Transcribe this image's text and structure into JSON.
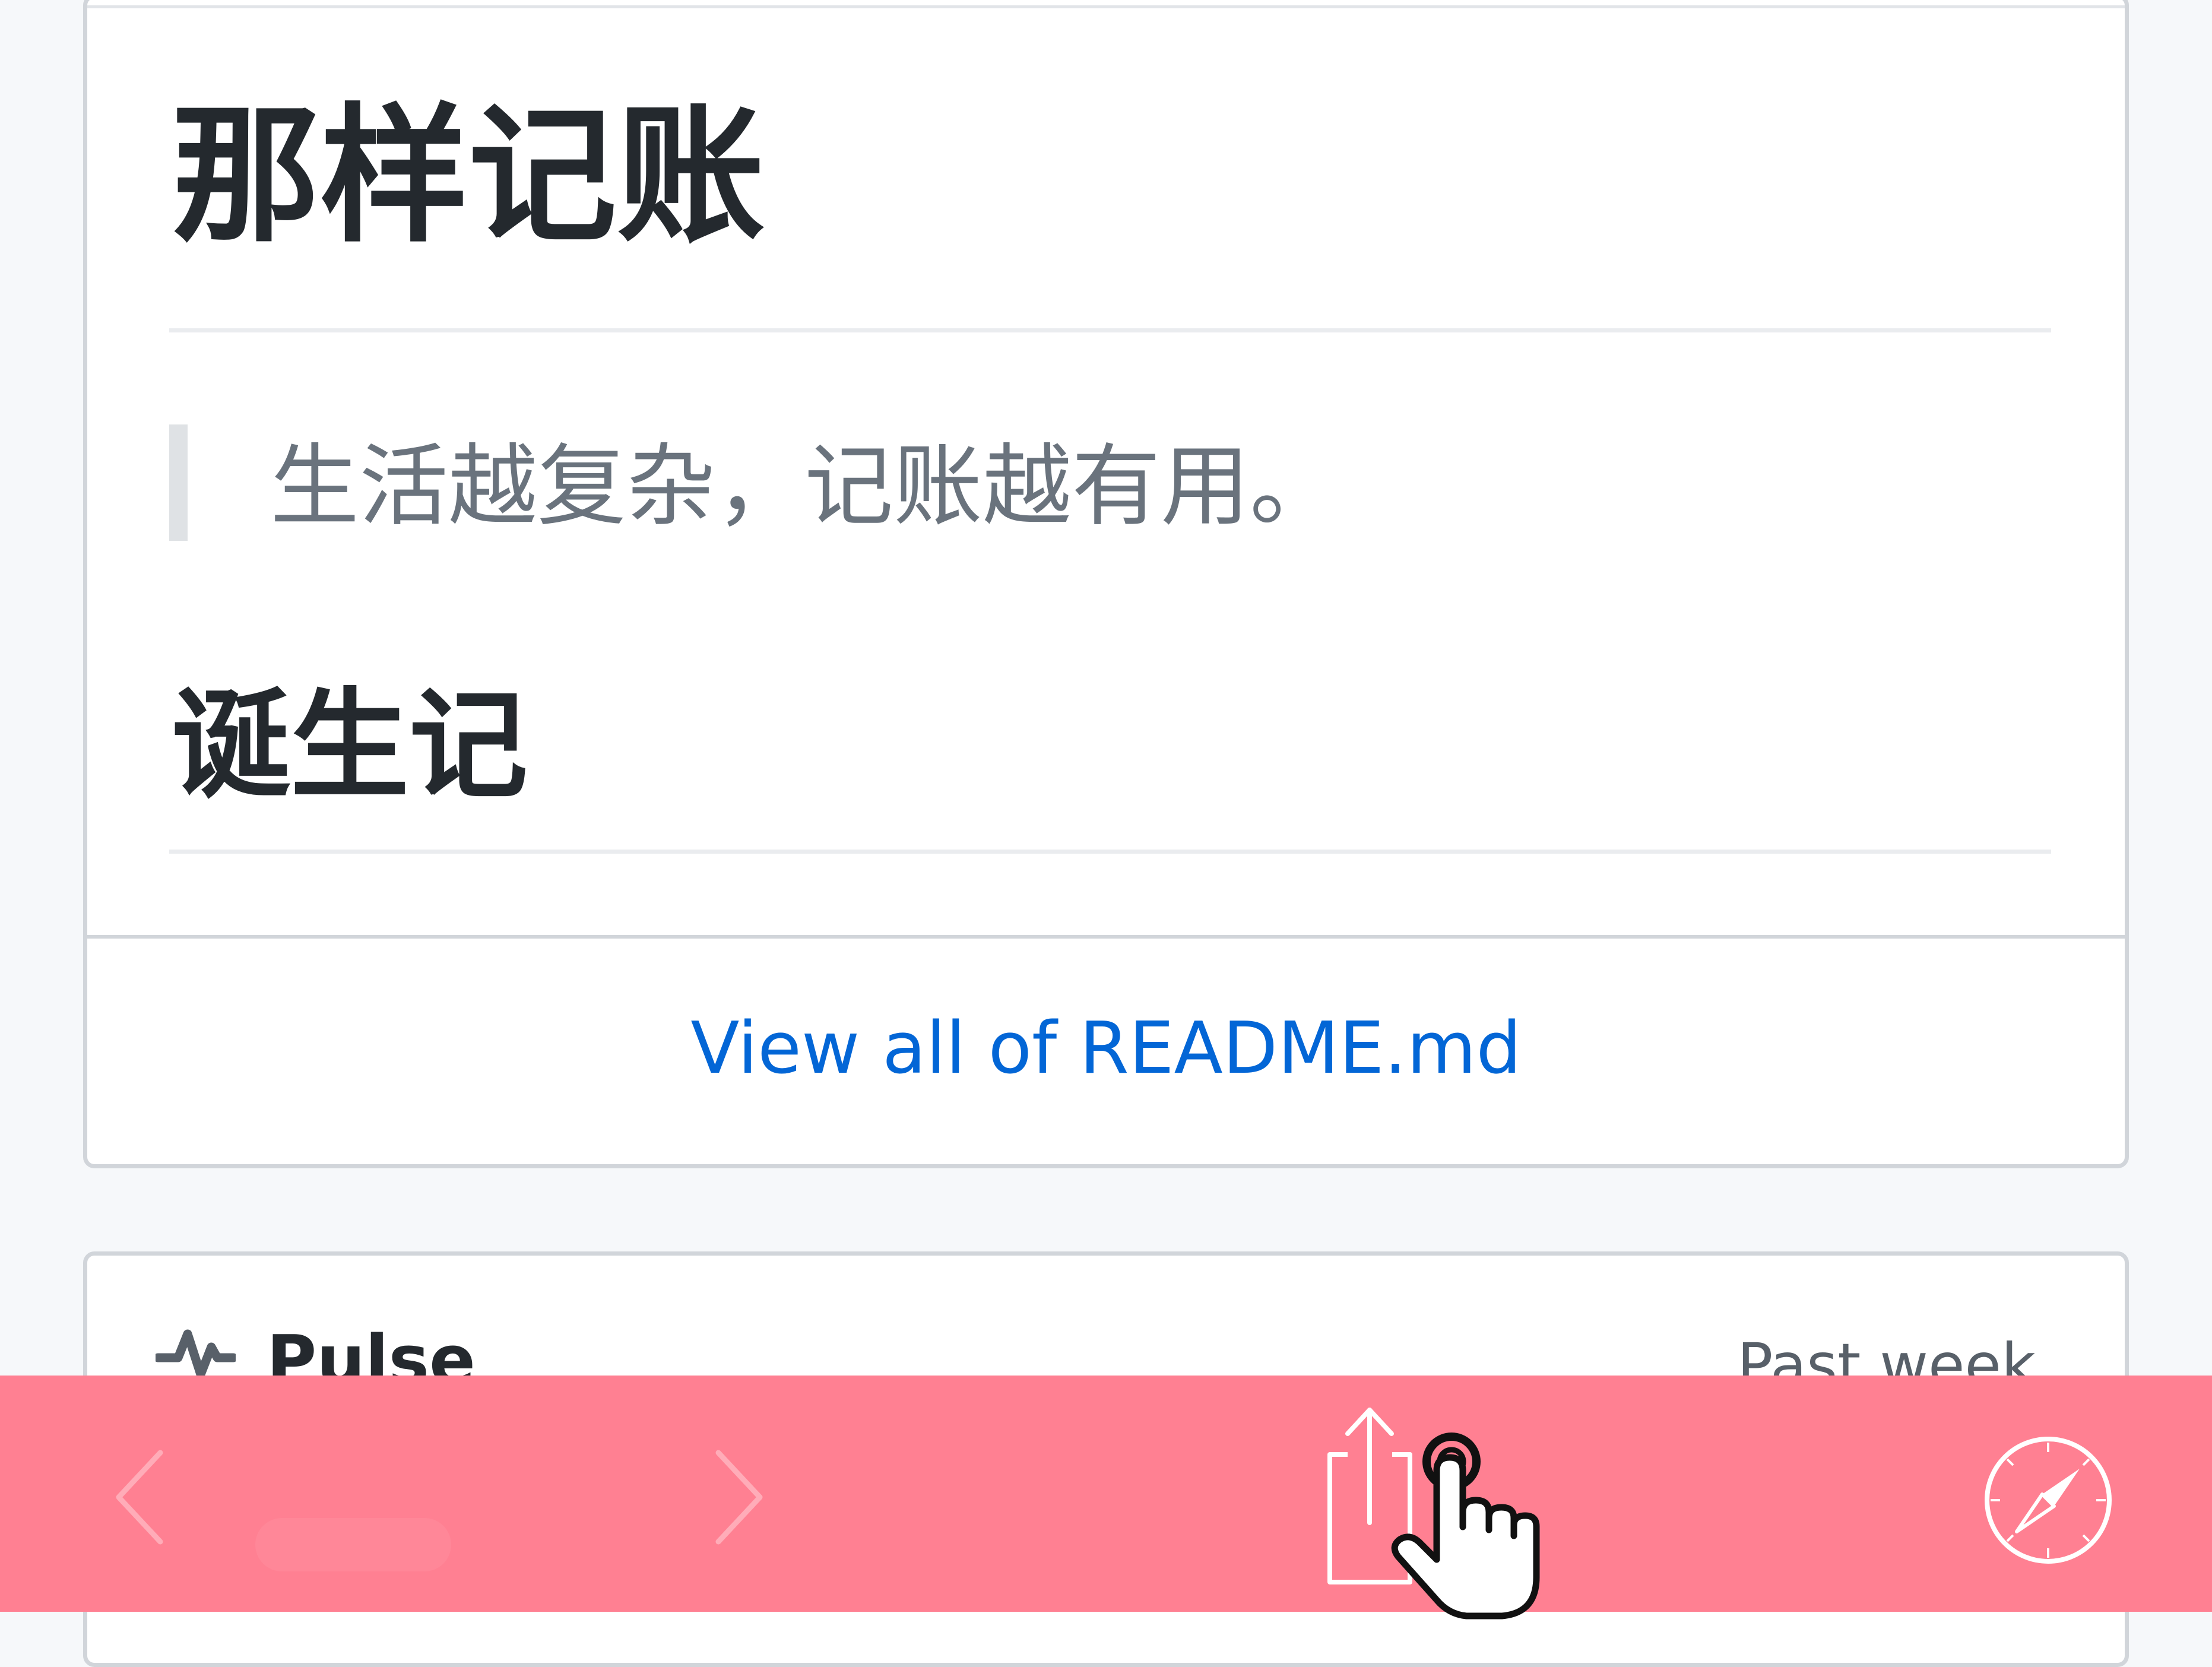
{
  "readme": {
    "heading": "那样记账",
    "quote": "生活越复杂，记账越有用。",
    "subheading": "诞生记",
    "view_all_label": "View all of README.md"
  },
  "pulse": {
    "title": "Pulse",
    "period": "Past week"
  },
  "toolbar": {
    "buttons": [
      {
        "name": "back",
        "icon": "chevron-left-icon",
        "enabled": false
      },
      {
        "name": "forward",
        "icon": "chevron-right-icon",
        "enabled": false
      },
      {
        "name": "share",
        "icon": "share-icon",
        "enabled": true
      },
      {
        "name": "open-in-safari",
        "icon": "compass-icon",
        "enabled": true
      }
    ],
    "background_color": "#ff8092",
    "icon_color": "#ffffff",
    "cursor_icon": "hand-pointer-icon"
  },
  "colors": {
    "link": "#0366d6",
    "heading": "#24292e",
    "quote_text": "#6a737d",
    "border": "#d1d5da",
    "page_background": "#f6f8fa"
  }
}
